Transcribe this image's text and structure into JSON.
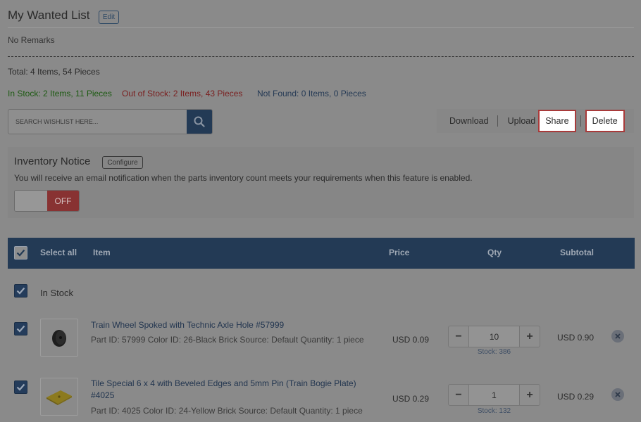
{
  "header": {
    "title": "My Wanted List",
    "edit_label": "Edit",
    "remarks": "No Remarks"
  },
  "summary": {
    "total": "Total: 4 Items, 54 Pieces",
    "in_stock": "In Stock: 2 Items, 11 Pieces",
    "out_of_stock": "Out of Stock: 2 Items, 43 Pieces",
    "not_found": "Not Found: 0 Items, 0 Pieces"
  },
  "search": {
    "placeholder": "SEARCH WISHLIST HERE...",
    "value": ""
  },
  "actions": {
    "download": "Download",
    "upload": "Upload",
    "share": "Share",
    "delete": "Delete"
  },
  "notice": {
    "title": "Inventory Notice",
    "configure_label": "Configure",
    "text": "You will receive an email notification when the parts inventory count meets your requirements when this feature is enabled.",
    "toggle_state": "OFF"
  },
  "table": {
    "select_all": "Select all",
    "columns": {
      "item": "Item",
      "price": "Price",
      "qty": "Qty",
      "subtotal": "Subtotal"
    },
    "section_label": "In Stock",
    "rows": [
      {
        "title": "Train Wheel Spoked with Technic Axle Hole #57999",
        "meta": "Part ID:  57999 Color ID:  26-Black Brick Source:  Default Quantity:  1 piece",
        "price": "USD 0.09",
        "qty": "10",
        "stock": "Stock: 386",
        "subtotal": "USD 0.90",
        "checked": true
      },
      {
        "title_line1": "Tile Special 6 x 4 with Beveled Edges and 5mm Pin (Train Bogie Plate)",
        "title_line2": "#4025",
        "meta": "Part ID:  4025 Color ID:  24-Yellow Brick Source:  Default Quantity:  1 piece",
        "price": "USD 0.29",
        "qty": "1",
        "stock": "Stock: 132",
        "subtotal": "USD 0.29",
        "checked": true
      }
    ]
  },
  "colors": {
    "accent": "#233a55",
    "in_stock": "#1d5a12",
    "out_of_stock": "#7a1f1f",
    "highlight_border": "#a83a3a"
  },
  "icons": {
    "search": "search-icon",
    "checkbox": "checkmark-icon",
    "remove": "close-circle-icon"
  }
}
